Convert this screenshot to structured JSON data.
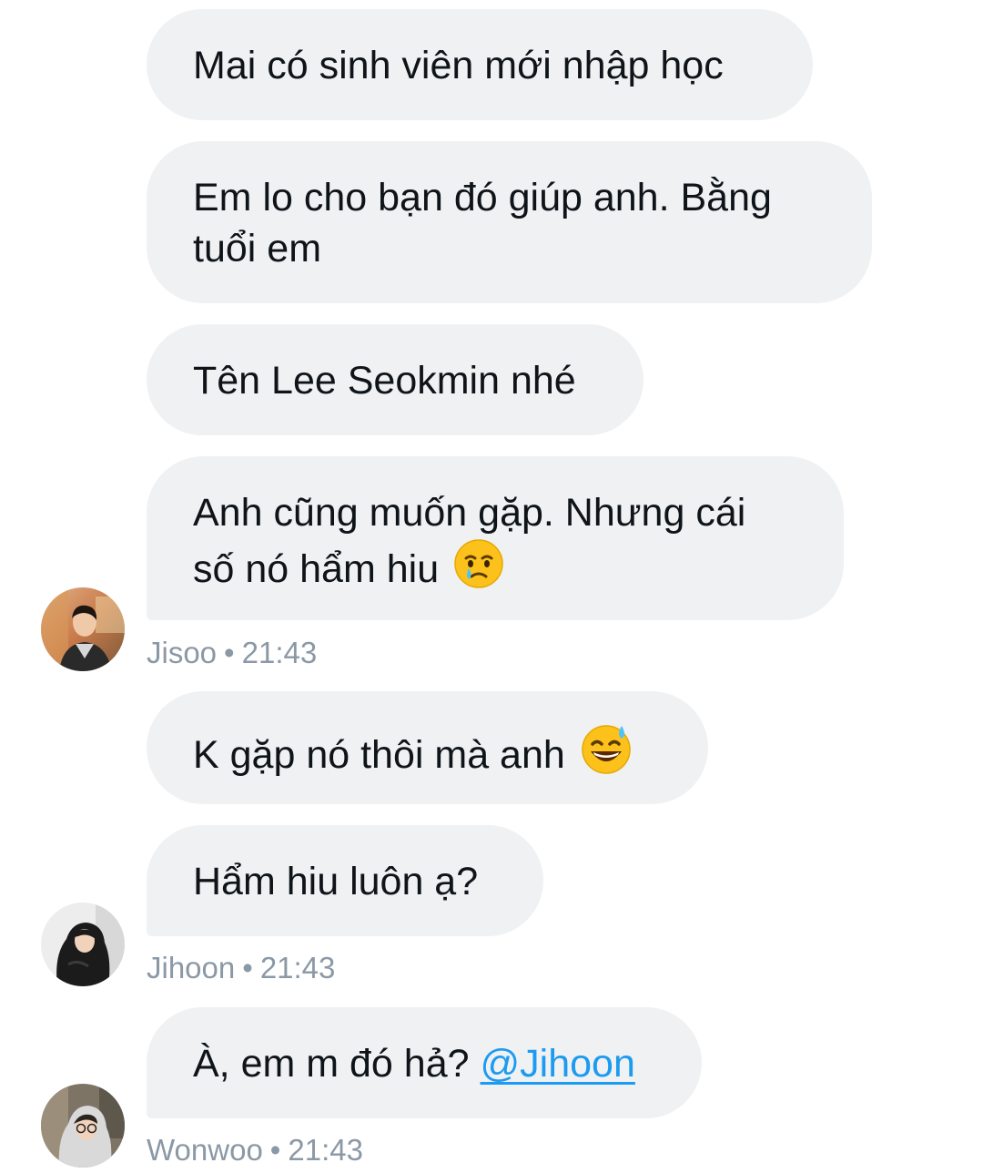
{
  "messages": [
    {
      "text": "Mai có sinh viên mới nhập học"
    },
    {
      "text": "Em lo cho bạn đó giúp anh. Bằng tuổi em"
    },
    {
      "text": "Tên Lee Seokmin nhé"
    },
    {
      "text": "Anh cũng muốn gặp. Nhưng cái số nó hẩm hiu",
      "emoji": "crying-face"
    }
  ],
  "group1": {
    "sender": "Jisoo",
    "separator": "•",
    "time": "21:43"
  },
  "messages2": [
    {
      "text": "K gặp nó thôi mà anh",
      "emoji": "grinning-sweat-face"
    },
    {
      "text": "Hẩm hiu luôn ạ?"
    }
  ],
  "group2": {
    "sender": "Jihoon",
    "separator": "•",
    "time": "21:43"
  },
  "messages3": [
    {
      "text": "À, em m đó hả? ",
      "mention": "@Jihoon"
    }
  ],
  "group3": {
    "sender": "Wonwoo",
    "separator": "•",
    "time": "21:43"
  },
  "colors": {
    "bubble_bg": "#eff1f3",
    "text": "#0f1419",
    "meta": "#8b98a5",
    "mention": "#1d9bf0"
  }
}
